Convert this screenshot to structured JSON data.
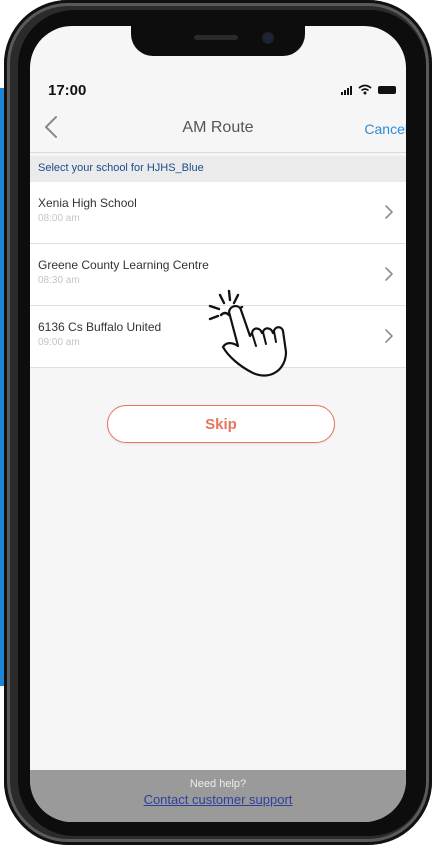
{
  "status_bar": {
    "time": "17:00"
  },
  "nav": {
    "title": "AM Route",
    "cancel_label": "Cancel"
  },
  "section": {
    "label": "Select your school for HJHS_Blue"
  },
  "schools": [
    {
      "name": "Xenia High School",
      "time": "08:00 am"
    },
    {
      "name": "Greene County Learning Centre",
      "time": "08:30 am"
    },
    {
      "name": "6136 Cs Buffalo United",
      "time": "09:00 am"
    }
  ],
  "skip_label": "Skip",
  "footer": {
    "need_help": "Need help?",
    "contact_label": "Contact customer support"
  },
  "colors": {
    "accent": "#e8745e",
    "link": "#2e8bd6",
    "section_text": "#1b4c8f",
    "footer_bg": "#9a9a9a",
    "side_bar": "#1d84d6"
  },
  "icons": [
    "back-chevron-icon",
    "chevron-right-icon",
    "signal-icon",
    "wifi-icon",
    "battery-icon",
    "tap-gesture-icon"
  ]
}
